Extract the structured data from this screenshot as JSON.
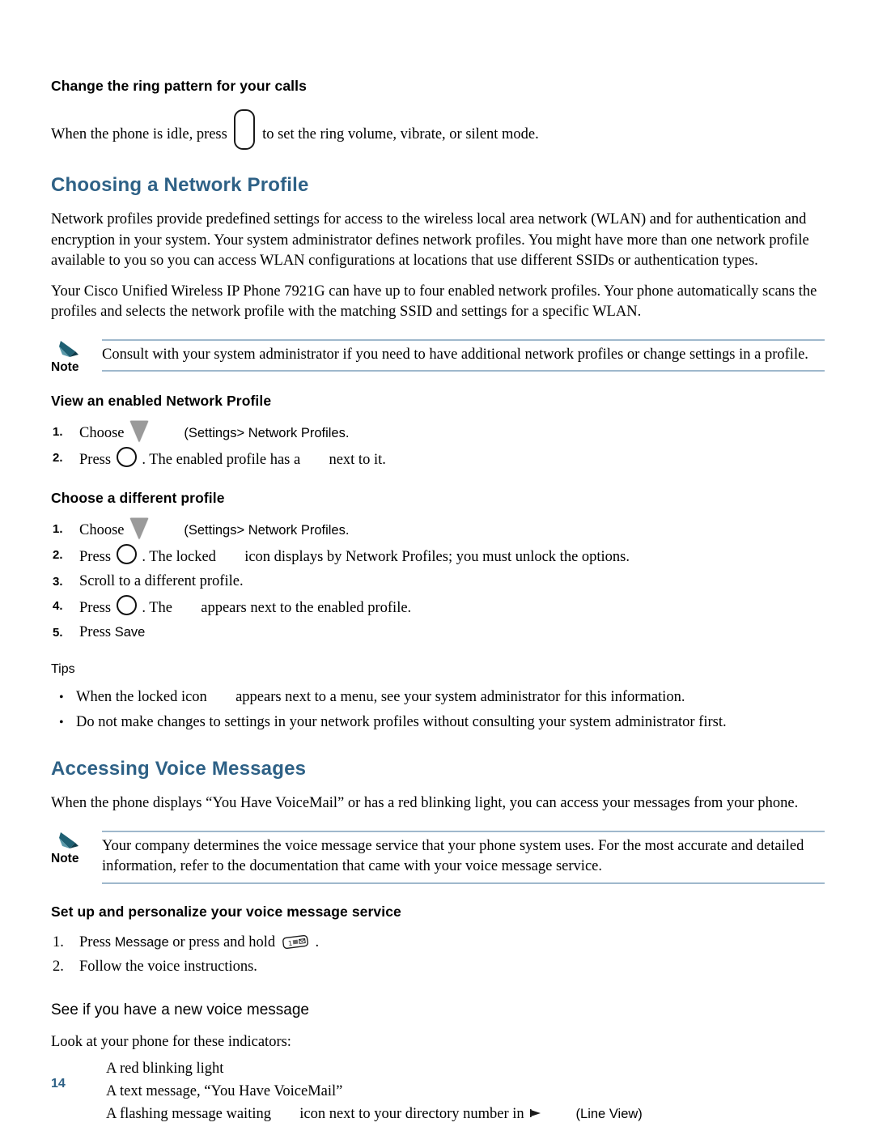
{
  "page": {
    "number": "14",
    "accent_color": "#2e6186",
    "rule_color": "#9fb8cc"
  },
  "ring_pattern": {
    "heading": "Change the ring pattern for your calls",
    "text_before": "When the phone is idle, press",
    "text_after": "to set the ring volume, vibrate, or silent mode.",
    "icon": "volume-key-icon"
  },
  "network_profile": {
    "heading": "Choosing a Network Profile",
    "paragraph_1": "Network profiles provide predefined settings for access to the wireless local area network (WLAN) and for authentication and encryption in your system. Your system administrator defines network profiles. You might have more than one network profile available to you so you can access WLAN configurations at locations that use different SSIDs or authentication types.",
    "paragraph_2": "Your Cisco Unified Wireless IP Phone 7921G can have up to four enabled network profiles. Your phone automatically scans the profiles and selects the network profile with the matching SSID and settings for a specific WLAN.",
    "note": {
      "label": "Note",
      "icon": "pencil-note-icon",
      "text": "Consult with your system administrator if you need to have additional network profiles or change settings in a profile."
    },
    "view_enabled": {
      "heading": "View an enabled Network Profile",
      "steps": [
        {
          "num": "1.",
          "before": "Choose",
          "icon": "settings-triangle-icon",
          "after_1": "(Settings",
          "after_2": "> Network Profiles",
          "after_3": "."
        },
        {
          "num": "2.",
          "before": "Press",
          "icon": "select-button-icon",
          "mid": ". The enabled profile has a",
          "icon2": "checkmark-icon",
          "after": "next to it."
        }
      ]
    },
    "choose_different": {
      "heading": "Choose a different profile",
      "steps": [
        {
          "num": "1.",
          "before": "Choose",
          "icon": "settings-triangle-icon",
          "after_1": "(Settings",
          "after_2": "> Network Profiles",
          "after_3": "."
        },
        {
          "num": "2.",
          "before": "Press",
          "icon": "select-button-icon",
          "mid": ". The locked",
          "icon2": "locked-icon",
          "after": "icon displays by Network Profiles; you must unlock the options."
        },
        {
          "num": "3.",
          "text": "Scroll to a different profile."
        },
        {
          "num": "4.",
          "before": "Press",
          "icon": "select-button-icon",
          "mid": ". The",
          "icon2": "checkmark-icon",
          "after": "appears next to the enabled profile."
        },
        {
          "num": "5.",
          "before": "Press",
          "softkey": "Save"
        }
      ]
    },
    "tips": {
      "heading": "Tips",
      "items": [
        {
          "before": "When the locked icon",
          "icon": "locked-icon",
          "after": "appears next to a menu, see your system administrator for this information."
        },
        {
          "text": "Do not make changes to settings in your network profiles without consulting your system administrator first."
        }
      ]
    }
  },
  "voice_messages": {
    "heading": "Accessing Voice Messages",
    "intro": "When the phone displays “You Have VoiceMail” or has a red blinking light, you can access your messages from your phone.",
    "note": {
      "label": "Note",
      "icon": "pencil-note-icon",
      "text": "Your company determines the voice message service that your phone system uses. For the most accurate and detailed information, refer to the documentation that came with your voice message service."
    },
    "setup": {
      "heading": "Set up and personalize your voice message service",
      "steps": [
        {
          "num": "1.",
          "before": "Press",
          "softkey": "Message",
          "mid": "or press and hold",
          "icon": "keypad-one-message-icon",
          "after": "."
        },
        {
          "num": "2.",
          "text": "Follow the voice instructions."
        }
      ]
    },
    "new_message": {
      "heading": "See if you have a new voice message",
      "intro": "Look at your phone for these indicators:",
      "indicators": [
        {
          "text": "A red blinking light"
        },
        {
          "text": "A text message, “You Have VoiceMail”"
        },
        {
          "before": "A flashing message waiting",
          "icon": "message-waiting-icon",
          "mid": "icon next to your directory number in",
          "icon2": "line-view-icon",
          "after": "(Line View)"
        }
      ]
    }
  }
}
